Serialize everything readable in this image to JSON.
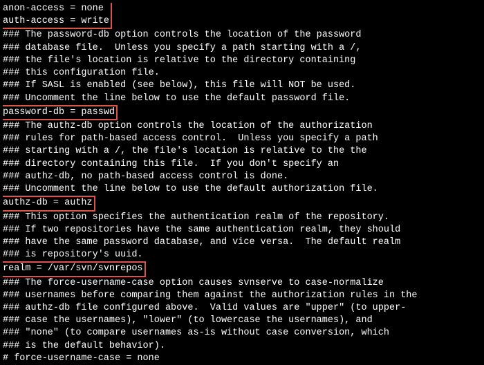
{
  "config_lines": {
    "box1_l0": "anon-access = none",
    "box1_l1": "auth-access = write",
    "c1_l0": "### The password-db option controls the location of the password",
    "c1_l1": "### database file.  Unless you specify a path starting with a /,",
    "c1_l2": "### the file's location is relative to the directory containing",
    "c1_l3": "### this configuration file.",
    "c1_l4": "### If SASL is enabled (see below), this file will NOT be used.",
    "c1_l5": "### Uncomment the line below to use the default password file.",
    "box2": "password-db = passwd",
    "c2_l0": "### The authz-db option controls the location of the authorization",
    "c2_l1": "### rules for path-based access control.  Unless you specify a path",
    "c2_l2": "### starting with a /, the file's location is relative to the the",
    "c2_l3": "### directory containing this file.  If you don't specify an",
    "c2_l4": "### authz-db, no path-based access control is done.",
    "c2_l5": "### Uncomment the line below to use the default authorization file.",
    "box3": "authz-db = authz",
    "c3_l0": "### This option specifies the authentication realm of the repository.",
    "c3_l1": "### If two repositories have the same authentication realm, they should",
    "c3_l2": "### have the same password database, and vice versa.  The default realm",
    "c3_l3": "### is repository's uuid.",
    "box4": "realm = /var/svn/svnrepos",
    "c4_l0": "### The force-username-case option causes svnserve to case-normalize",
    "c4_l1": "### usernames before comparing them against the authorization rules in the",
    "c4_l2": "### authz-db file configured above.  Valid values are \"upper\" (to upper-",
    "c4_l3": "### case the usernames), \"lower\" (to lowercase the usernames), and",
    "c4_l4": "### \"none\" (to compare usernames as-is without case conversion, which",
    "c4_l5": "### is the default behavior).",
    "force": "# force-username-case = none"
  },
  "highlight_color": "#d9534f"
}
